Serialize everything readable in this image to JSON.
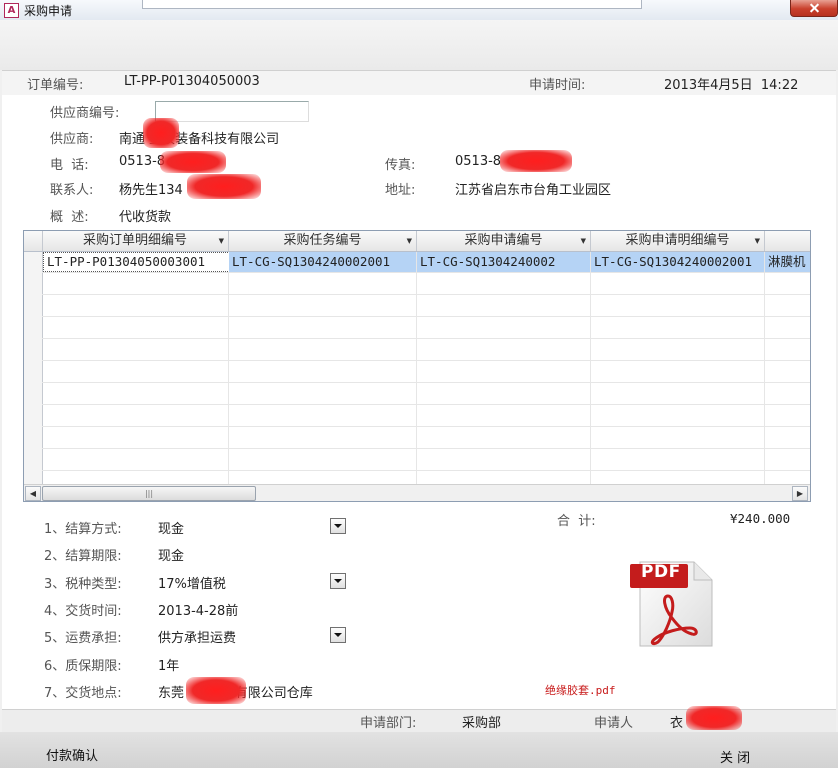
{
  "window": {
    "title": "采购申请",
    "app_icon_letter": "A"
  },
  "header": {
    "order_no_label": "订单编号:",
    "order_no": "LT-PP-P01304050003",
    "apply_time_label": "申请时间:",
    "apply_time": "2013年4月5日  14:22"
  },
  "supplier": {
    "code_label": "供应商编号:",
    "code_value": "",
    "name_label": "供应商:",
    "name": "南通 塑胶装备科技有限公司",
    "phone_label": "电  话:",
    "phone": "0513-8",
    "fax_label": "传真:",
    "fax": "0513-8",
    "contact_label": "联系人:",
    "contact": "杨先生134",
    "address_label": "地址:",
    "address": "江苏省启东市台角工业园区",
    "summary_label": "概  述:",
    "summary": "代收货款"
  },
  "grid": {
    "columns": [
      "采购订单明细编号",
      "采购任务编号",
      "采购申请编号",
      "采购申请明细编号"
    ],
    "rows": [
      [
        "LT-PP-P01304050003001",
        "LT-CG-SQ1304240002001",
        "LT-CG-SQ1304240002",
        "LT-CG-SQ1304240002001",
        "淋膜机"
      ]
    ],
    "scroll_thumb_glyph": "|||"
  },
  "terms": [
    {
      "label": "1、结算方式:",
      "value": "现金",
      "dropdown": true
    },
    {
      "label": "2、结算期限:",
      "value": "现金",
      "dropdown": false
    },
    {
      "label": "3、税种类型:",
      "value": "17%增值税",
      "dropdown": true
    },
    {
      "label": "4、交货时间:",
      "value": "2013-4-28前",
      "dropdown": false
    },
    {
      "label": "5、运费承担:",
      "value": "供方承担运费",
      "dropdown": true
    },
    {
      "label": "6、质保期限:",
      "value": "1年",
      "dropdown": false
    },
    {
      "label": "7、交货地点:",
      "value": "东莞      实业有限公司仓库",
      "dropdown": false
    }
  ],
  "total": {
    "label": "合  计:",
    "value": "¥240.000"
  },
  "attachment": {
    "icon_text": "PDF",
    "file_name": "绝缘胶套.pdf"
  },
  "footer": {
    "dept_label": "申请部门:",
    "dept": "采购部",
    "applicant_label": "申请人",
    "applicant": "衣"
  },
  "actions": {
    "confirm_payment": "付款确认",
    "close": "关 闭"
  },
  "colors": {
    "accent_selection": "#b5d3f5",
    "redaction": "#f02828",
    "pdf_red": "#c41c1c"
  }
}
